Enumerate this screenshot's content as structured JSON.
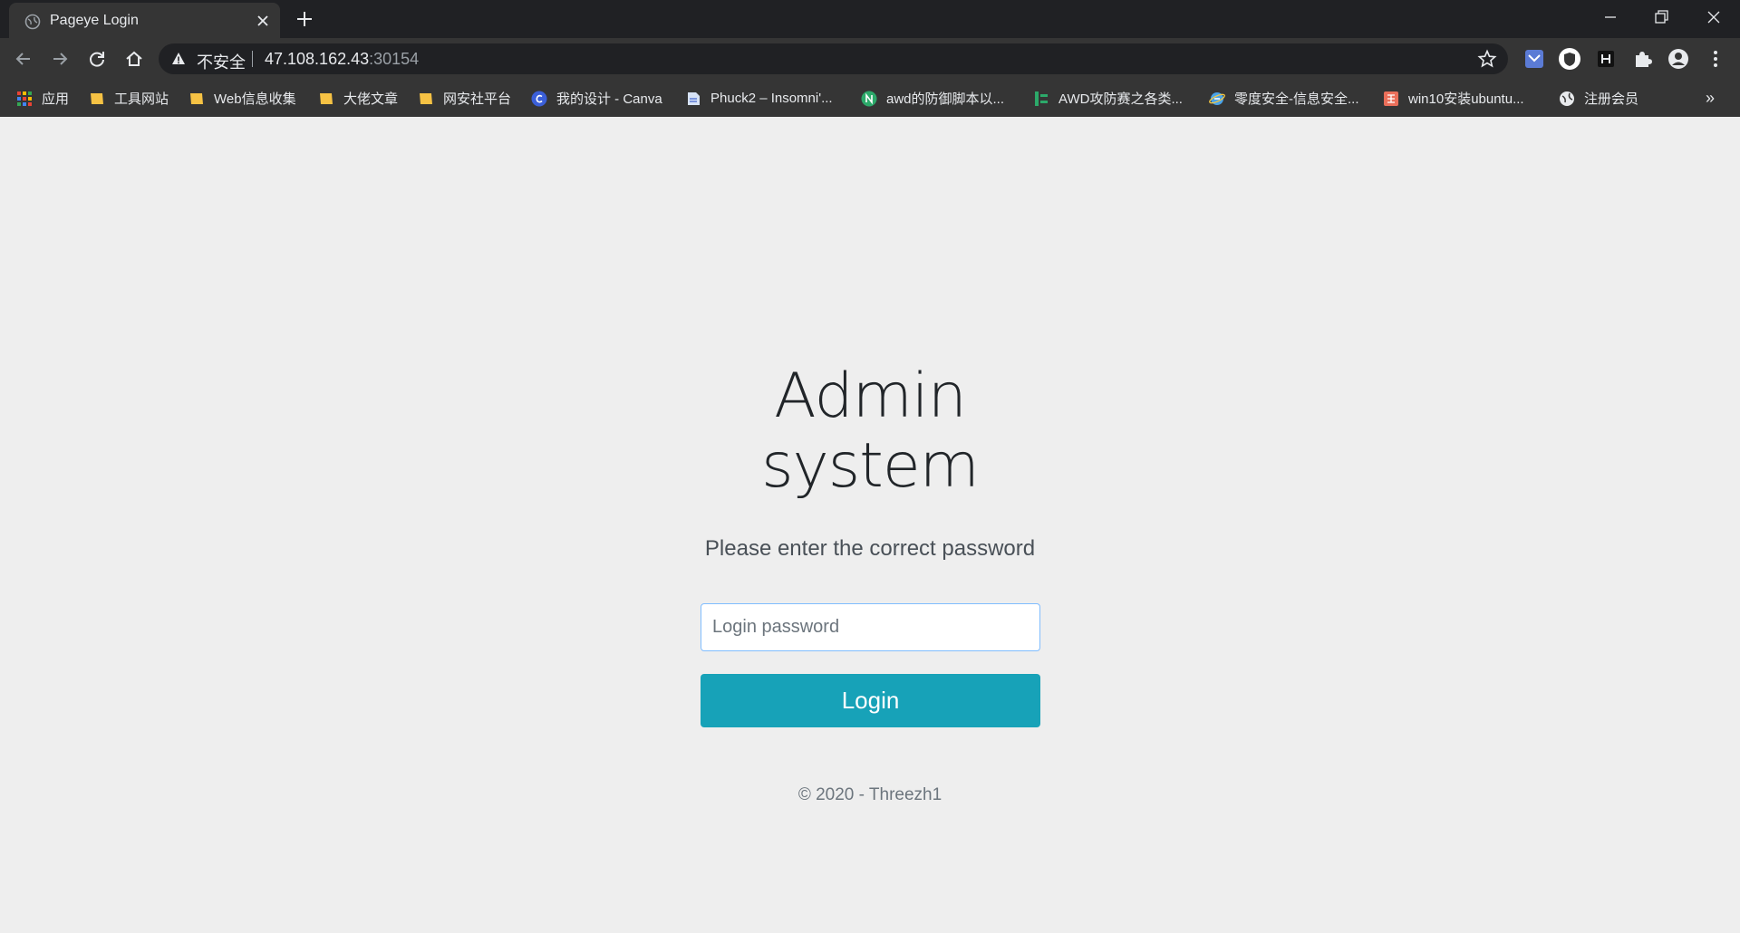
{
  "browser": {
    "tab_title": "Pageye Login",
    "insecure_label": "不安全",
    "url_host": "47.108.162.43",
    "url_port": ":30154",
    "bookmarks": [
      {
        "label": "应用",
        "icon": "apps-grid-icon"
      },
      {
        "label": "工具网站",
        "icon": "folder-icon"
      },
      {
        "label": "Web信息收集",
        "icon": "folder-icon"
      },
      {
        "label": "大佬文章",
        "icon": "folder-icon"
      },
      {
        "label": "网安社平台",
        "icon": "folder-icon"
      },
      {
        "label": "我的设计 - Canva",
        "icon": "canva-icon"
      },
      {
        "label": "Phuck2 – Insomni'...",
        "icon": "page-icon"
      },
      {
        "label": "awd的防御脚本以...",
        "icon": "n-icon"
      },
      {
        "label": "AWD攻防赛之各类...",
        "icon": "green-bars-icon"
      },
      {
        "label": "零度安全-信息安全...",
        "icon": "ie-icon"
      },
      {
        "label": "win10安装ubuntu...",
        "icon": "jian-icon"
      },
      {
        "label": "注册会员",
        "icon": "globe-icon"
      }
    ],
    "more_label": "»"
  },
  "page": {
    "title_line1": "Admin",
    "title_line2": "system",
    "subtitle": "Please enter the correct password",
    "password_placeholder": "Login password",
    "password_value": "",
    "login_label": "Login",
    "footer": "© 2020 - Threezh1"
  },
  "colors": {
    "accent": "#17a2b8",
    "page_bg": "#eeeeee",
    "chrome_bg": "#353535"
  }
}
